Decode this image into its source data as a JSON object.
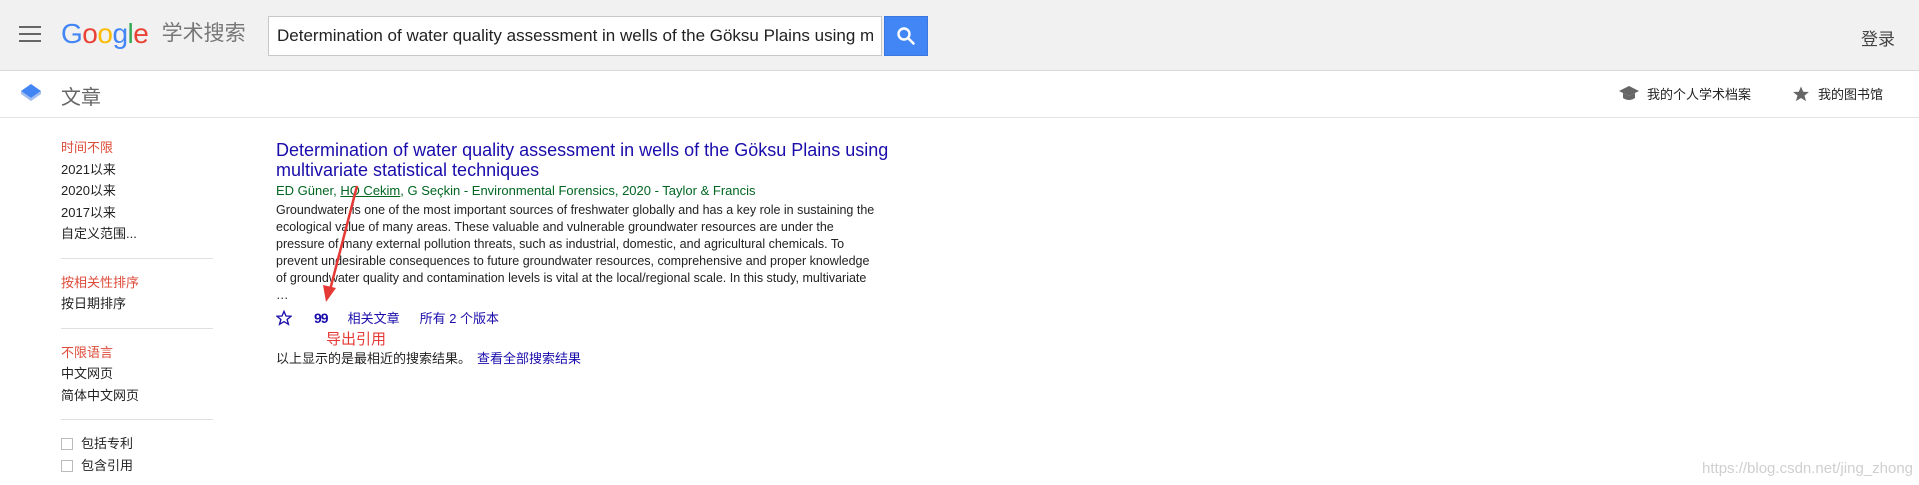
{
  "header": {
    "logo_parts": [
      "G",
      "o",
      "o",
      "g",
      "l",
      "e"
    ],
    "logo_suffix": "学术搜索",
    "search_value": "Determination of water quality assessment in wells of the Göksu Plains using multivariate statistical techniques",
    "login_label": "登录"
  },
  "subheader": {
    "title": "文章",
    "profile_label": "我的个人学术档案",
    "library_label": "我的图书馆"
  },
  "sidebar": {
    "time_items": [
      "时间不限",
      "2021以来",
      "2020以来",
      "2017以来",
      "自定义范围..."
    ],
    "sort_items": [
      "按相关性排序",
      "按日期排序"
    ],
    "lang_items": [
      "不限语言",
      "中文网页",
      "简体中文网页"
    ],
    "checkbox_items": [
      "包括专利",
      "包含引用"
    ]
  },
  "result": {
    "title": "Determination of water quality assessment in wells of the Göksu Plains using multivariate statistical techniques",
    "author_first": "ED Güner, ",
    "author_link": "HO Cekim",
    "author_rest": ", G Seçkin - Environmental Forensics, 2020 - Taylor & Francis",
    "snippet": "Groundwater is one of the most important sources of freshwater globally and has a key role in sustaining the ecological value of many areas. These valuable and vulnerable groundwater resources are under the pressure of many external pollution threats, such as industrial, domestic, and agricultural chemicals. To prevent undesirable consequences to future groundwater resources, comprehensive and proper knowledge of groundwater quality and contamination levels is vital at the local/regional scale. In this study, multivariate …",
    "cite_symbol": "99",
    "related_label": "相关文章",
    "versions_label": "所有 2 个版本"
  },
  "annotation": {
    "cite_label": "导出引用"
  },
  "footer": {
    "note": "以上显示的是最相近的搜索结果。",
    "view_all": "查看全部搜索结果"
  },
  "watermark": "https://blog.csdn.net/jing_zhong",
  "colors": {
    "accent_blue": "#4285f4",
    "link": "#1a0dab",
    "active_red": "#dd4b39",
    "meta_green": "#006621",
    "annotation_red": "#e53935"
  },
  "icons": [
    "hamburger-menu-icon",
    "search-icon",
    "articles-icon",
    "scholar-cap-icon",
    "star-icon",
    "star-outline-icon",
    "cite-quote-icon"
  ]
}
